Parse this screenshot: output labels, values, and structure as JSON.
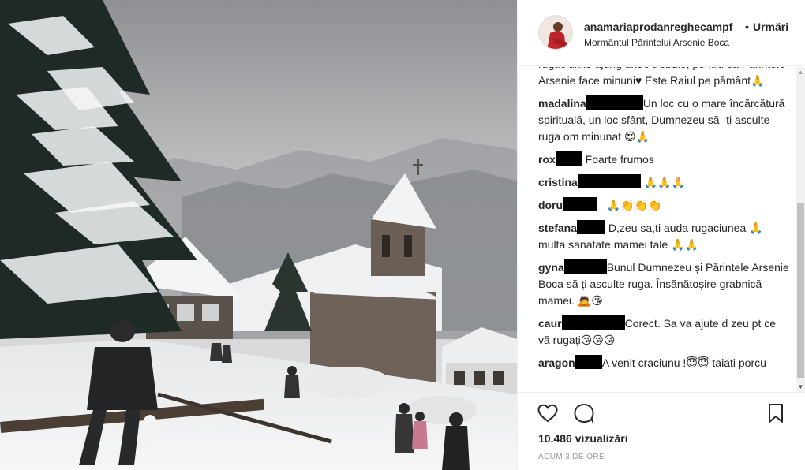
{
  "post": {
    "username": "anamariaprodanreghecampf",
    "separator": "•",
    "follow_label": "Urmări",
    "location": "Mormântul Părintelui Arsenie Boca"
  },
  "comments": [
    {
      "name": "",
      "text": "rugăciunile ajung unde trebuie, pentru că Părintele Arsenie face minuni",
      "heart": "♥",
      "after": " Este Raiul pe pământ",
      "emoji": "🙏"
    },
    {
      "name": "madalina",
      "text": "Un loc cu o mare încărcătură spirituală, un loc sfânt, Dumnezeu să -ți asculte ruga om minunat ",
      "emoji": "😍🙏"
    },
    {
      "name": "rox",
      "text": " Foarte frumos",
      "emoji": ""
    },
    {
      "name": "cristina",
      "text": " ",
      "emoji": "🙏🙏🙏"
    },
    {
      "name": "doru",
      "text": "_ ",
      "emoji": "🙏👏👏👏"
    },
    {
      "name": "stefana",
      "text": " D,zeu sa,ti auda rugaciunea ",
      "emoji_mid": "🙏",
      "after": " multa sanatate mamei tale ",
      "emoji": "🙏🙏"
    },
    {
      "name": "gyna",
      "text": "Bunul Dumnezeu și Părintele Arsenie Boca să ți asculte ruga. Însănătoșire grabnică mamei. ",
      "emoji": "🙇😘"
    },
    {
      "name": "caur",
      "text": "Corect. Sa va ajute d zeu pt ce vă rugați",
      "emoji": "😘😘😘"
    },
    {
      "name": "aragon",
      "text": "A venit craciunu !",
      "emoji_mid": "😇😇",
      "after": " taiati porcu",
      "emoji": ""
    }
  ],
  "actions": {
    "views": "10.486 vizualizări",
    "time": "Acum 3 de ore"
  },
  "icons": {
    "like": "heart-outline-icon",
    "comment": "speech-bubble-icon",
    "save": "bookmark-icon"
  }
}
